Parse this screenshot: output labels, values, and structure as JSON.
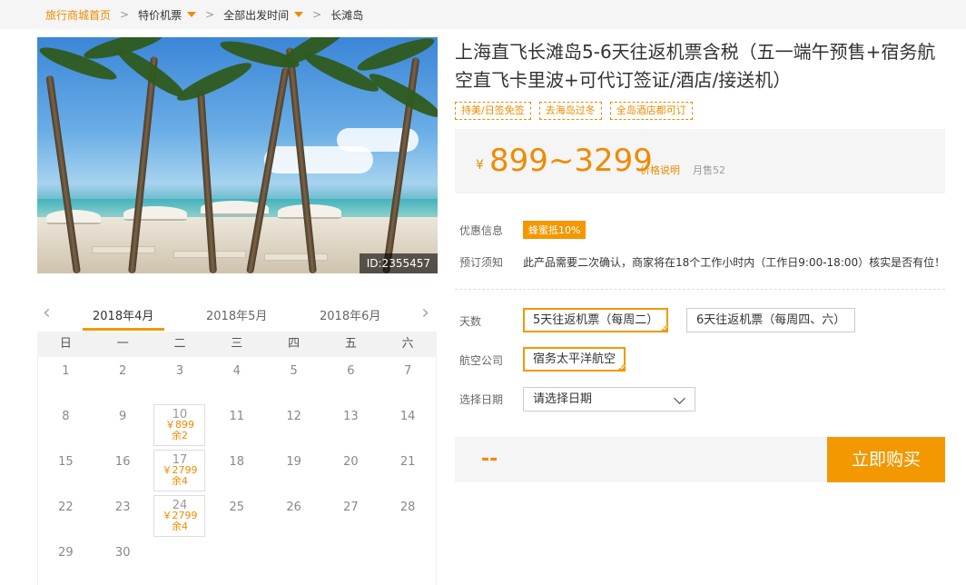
{
  "breadcrumb": {
    "home": "旅行商城首页",
    "category": "特价机票",
    "departure": "全部出发时间",
    "destination": "长滩岛",
    "separator": ">"
  },
  "product": {
    "image_id": "ID:2355457",
    "title": "上海直飞长滩岛5-6天往返机票含税（五一端午预售+宿务航空直飞卡里波+可代订签证/酒店/接送机）",
    "tags": [
      "持美/日签免签",
      "去海岛过冬",
      "全岛酒店都可订"
    ],
    "price": {
      "currency": "¥",
      "range": "899~3299",
      "explain_label": "价格说明",
      "monthly_sales": "月售52"
    },
    "promo": {
      "label": "优惠信息",
      "badge": "蜂蜜抵10%"
    },
    "notice": {
      "label": "预订须知",
      "text": "此产品需要二次确认，商家将在18个工作小时内（工作日9:00-18:00）核实是否有位！"
    },
    "days": {
      "label": "天数",
      "options": [
        {
          "text": "5天往返机票（每周二）",
          "selected": true
        },
        {
          "text": "6天往返机票（每周四、六）",
          "selected": false
        }
      ]
    },
    "airline": {
      "label": "航空公司",
      "options": [
        {
          "text": "宿务太平洋航空",
          "selected": true
        }
      ]
    },
    "date": {
      "label": "选择日期",
      "placeholder": "请选择日期"
    },
    "buy": {
      "price_placeholder": "--",
      "button": "立即购买"
    }
  },
  "calendar": {
    "months": [
      {
        "label": "2018年4月",
        "active": true
      },
      {
        "label": "2018年5月",
        "active": false
      },
      {
        "label": "2018年6月",
        "active": false
      }
    ],
    "weekdays": [
      "日",
      "一",
      "二",
      "三",
      "四",
      "五",
      "六"
    ],
    "days": [
      {
        "d": "1"
      },
      {
        "d": "2"
      },
      {
        "d": "3"
      },
      {
        "d": "4"
      },
      {
        "d": "5"
      },
      {
        "d": "6"
      },
      {
        "d": "7"
      },
      {
        "d": "8"
      },
      {
        "d": "9"
      },
      {
        "d": "10",
        "price": "￥899",
        "remain": "余2"
      },
      {
        "d": "11"
      },
      {
        "d": "12"
      },
      {
        "d": "13"
      },
      {
        "d": "14"
      },
      {
        "d": "15"
      },
      {
        "d": "16"
      },
      {
        "d": "17",
        "price": "￥2799",
        "remain": "余4"
      },
      {
        "d": "18"
      },
      {
        "d": "19"
      },
      {
        "d": "20"
      },
      {
        "d": "21"
      },
      {
        "d": "22"
      },
      {
        "d": "23"
      },
      {
        "d": "24",
        "price": "￥2799",
        "remain": "余4"
      },
      {
        "d": "25"
      },
      {
        "d": "26"
      },
      {
        "d": "27"
      },
      {
        "d": "28"
      },
      {
        "d": "29"
      },
      {
        "d": "30"
      }
    ]
  },
  "colors": {
    "accent": "#f39800",
    "accent_text": "#f08a00"
  },
  "icons": {
    "prev": "chevron-left-icon",
    "next": "chevron-right-icon",
    "dropdown": "caret-down-icon"
  }
}
